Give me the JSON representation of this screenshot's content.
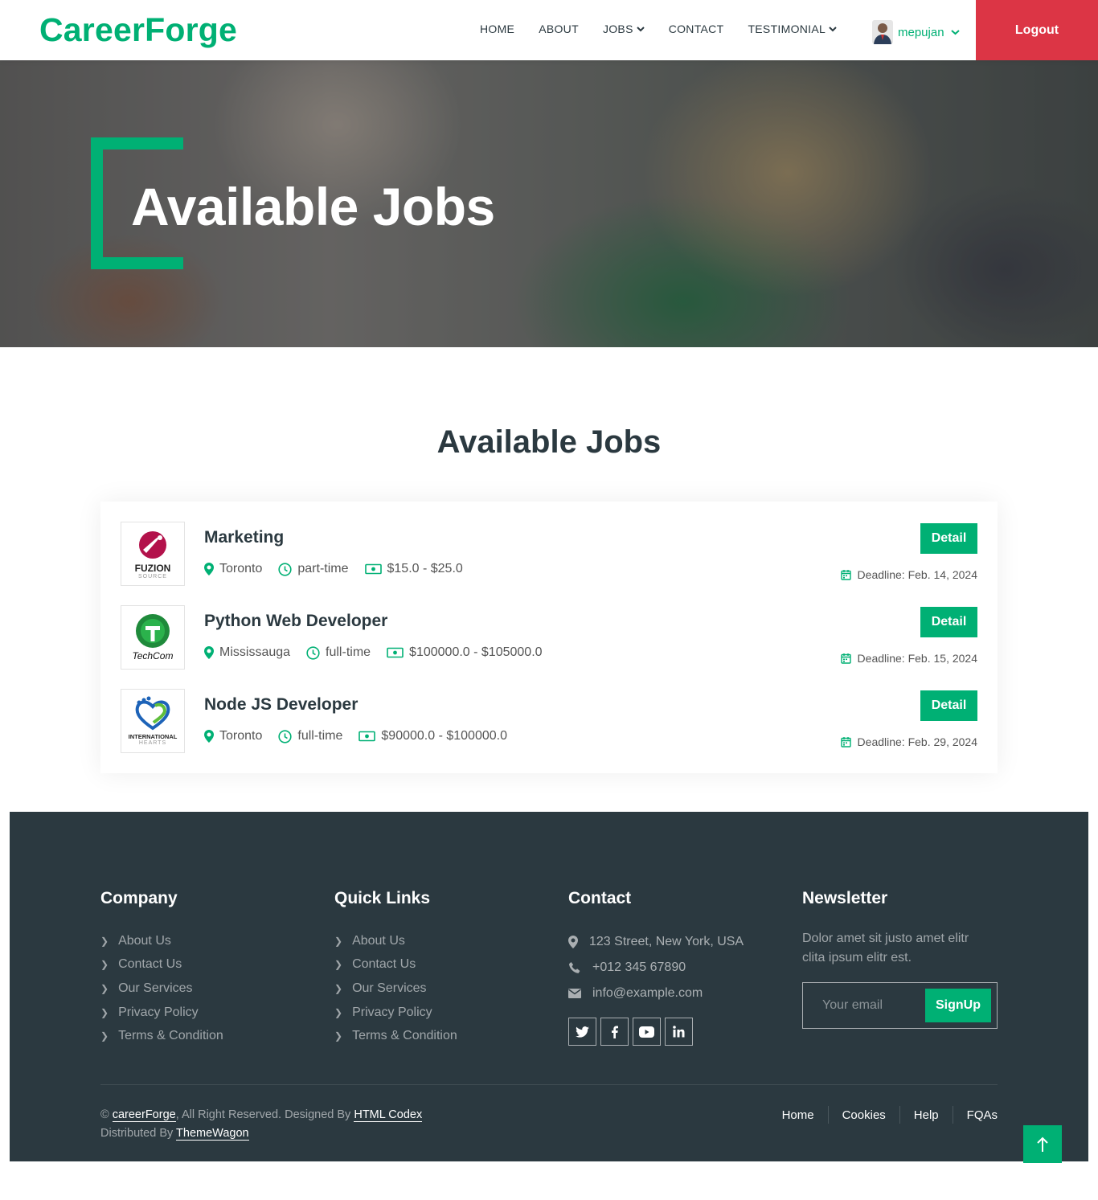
{
  "nav": {
    "brand": "CareerForge",
    "links": [
      "HOME",
      "ABOUT",
      "JOBS",
      "CONTACT",
      "TESTIMONIAL"
    ],
    "user": "mepujan",
    "logout": "Logout"
  },
  "hero": {
    "title": "Available Jobs"
  },
  "section": {
    "title": "Available Jobs"
  },
  "jobs": [
    {
      "title": "Marketing",
      "company_logo_text": "FUZION",
      "company_logo_sub": "SOURCE",
      "location": "Toronto",
      "type": "part-time",
      "salary": "$15.0 - $25.0",
      "deadline": "Deadline: Feb. 14, 2024",
      "button": "Detail"
    },
    {
      "title": "Python Web Developer",
      "company_logo_text": "TechCom",
      "company_logo_sub": "",
      "location": "Mississauga",
      "type": "full-time",
      "salary": "$100000.0 - $105000.0",
      "deadline": "Deadline: Feb. 15, 2024",
      "button": "Detail"
    },
    {
      "title": "Node JS Developer",
      "company_logo_text": "INTERNATIONAL",
      "company_logo_sub": "HEARTS",
      "location": "Toronto",
      "type": "full-time",
      "salary": "$90000.0 - $100000.0",
      "deadline": "Deadline: Feb. 29, 2024",
      "button": "Detail"
    }
  ],
  "footer": {
    "company": {
      "title": "Company",
      "links": [
        "About Us",
        "Contact Us",
        "Our Services",
        "Privacy Policy",
        "Terms & Condition"
      ]
    },
    "quick": {
      "title": "Quick Links",
      "links": [
        "About Us",
        "Contact Us",
        "Our Services",
        "Privacy Policy",
        "Terms & Condition"
      ]
    },
    "contact": {
      "title": "Contact",
      "address": "123 Street, New York, USA",
      "phone": "+012 345 67890",
      "email": "info@example.com"
    },
    "newsletter": {
      "title": "Newsletter",
      "text": "Dolor amet sit justo amet elitr clita ipsum elitr est.",
      "placeholder": "Your email",
      "button": "SignUp"
    },
    "copyright": {
      "prefix": "©",
      "site": "careerForge",
      "mid": ", All Right Reserved. Designed By",
      "designer": "HTML Codex",
      "dist": "Distributed By",
      "distributor": "ThemeWagon"
    },
    "menu": [
      "Home",
      "Cookies",
      "Help",
      "FQAs"
    ]
  },
  "colors": {
    "accent": "#00b074",
    "logout": "#dc3545",
    "footer_bg": "#2b3940"
  }
}
